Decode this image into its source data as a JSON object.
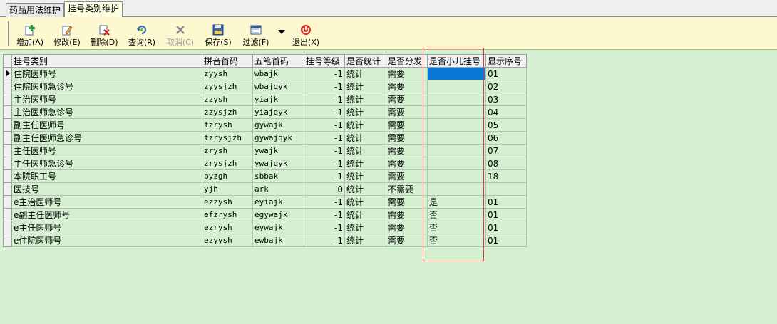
{
  "tabs": [
    {
      "label": "药品用法维护"
    },
    {
      "label": "挂号类别维护"
    }
  ],
  "toolbar": {
    "add": "增加(A)",
    "edit": "修改(E)",
    "delete": "删除(D)",
    "query": "查询(R)",
    "cancel": "取消(C)",
    "save": "保存(S)",
    "filter": "过滤(F)",
    "exit": "退出(X)"
  },
  "grid": {
    "headers": [
      "挂号类别",
      "拼音首码",
      "五笔首码",
      "挂号等级",
      "是否统计",
      "是否分发",
      "是否小儿挂号",
      "显示序号"
    ],
    "rows": [
      [
        "住院医师号",
        "zyysh",
        "wbajk",
        "-1",
        "统计",
        "需要",
        "",
        "01"
      ],
      [
        "住院医师急诊号",
        "zyysjzh",
        "wbajqyk",
        "-1",
        "统计",
        "需要",
        "",
        "02"
      ],
      [
        "主治医师号",
        "zzysh",
        "yiajk",
        "-1",
        "统计",
        "需要",
        "",
        "03"
      ],
      [
        "主治医师急诊号",
        "zzysjzh",
        "yiajqyk",
        "-1",
        "统计",
        "需要",
        "",
        "04"
      ],
      [
        "副主任医师号",
        "fzrysh",
        "gywajk",
        "-1",
        "统计",
        "需要",
        "",
        "05"
      ],
      [
        "副主任医师急诊号",
        "fzrysjzh",
        "gywajqyk",
        "-1",
        "统计",
        "需要",
        "",
        "06"
      ],
      [
        "主任医师号",
        "zrysh",
        "ywajk",
        "-1",
        "统计",
        "需要",
        "",
        "07"
      ],
      [
        "主任医师急诊号",
        "zrysjzh",
        "ywajqyk",
        "-1",
        "统计",
        "需要",
        "",
        "08"
      ],
      [
        "本院职工号",
        "byzgh",
        "sbbak",
        "-1",
        "统计",
        "需要",
        "",
        "18"
      ],
      [
        "医技号",
        "yjh",
        "ark",
        "0",
        "统计",
        "不需要",
        "",
        ""
      ],
      [
        "e主治医师号",
        "ezzysh",
        "eyiajk",
        "-1",
        "统计",
        "需要",
        "是",
        "01"
      ],
      [
        "e副主任医师号",
        "efzrysh",
        "egywajk",
        "-1",
        "统计",
        "需要",
        "否",
        "01"
      ],
      [
        "e主任医师号",
        "ezrysh",
        "eywajk",
        "-1",
        "统计",
        "需要",
        "否",
        "01"
      ],
      [
        "e住院医师号",
        "ezyysh",
        "ewbajk",
        "-1",
        "统计",
        "需要",
        "否",
        "01"
      ]
    ]
  },
  "colors": {
    "grid_background": "#d4f0d0",
    "toolbar_background": "#fdf8cf",
    "selection": "#0a78d7",
    "highlight_box": "#d83a3a"
  }
}
